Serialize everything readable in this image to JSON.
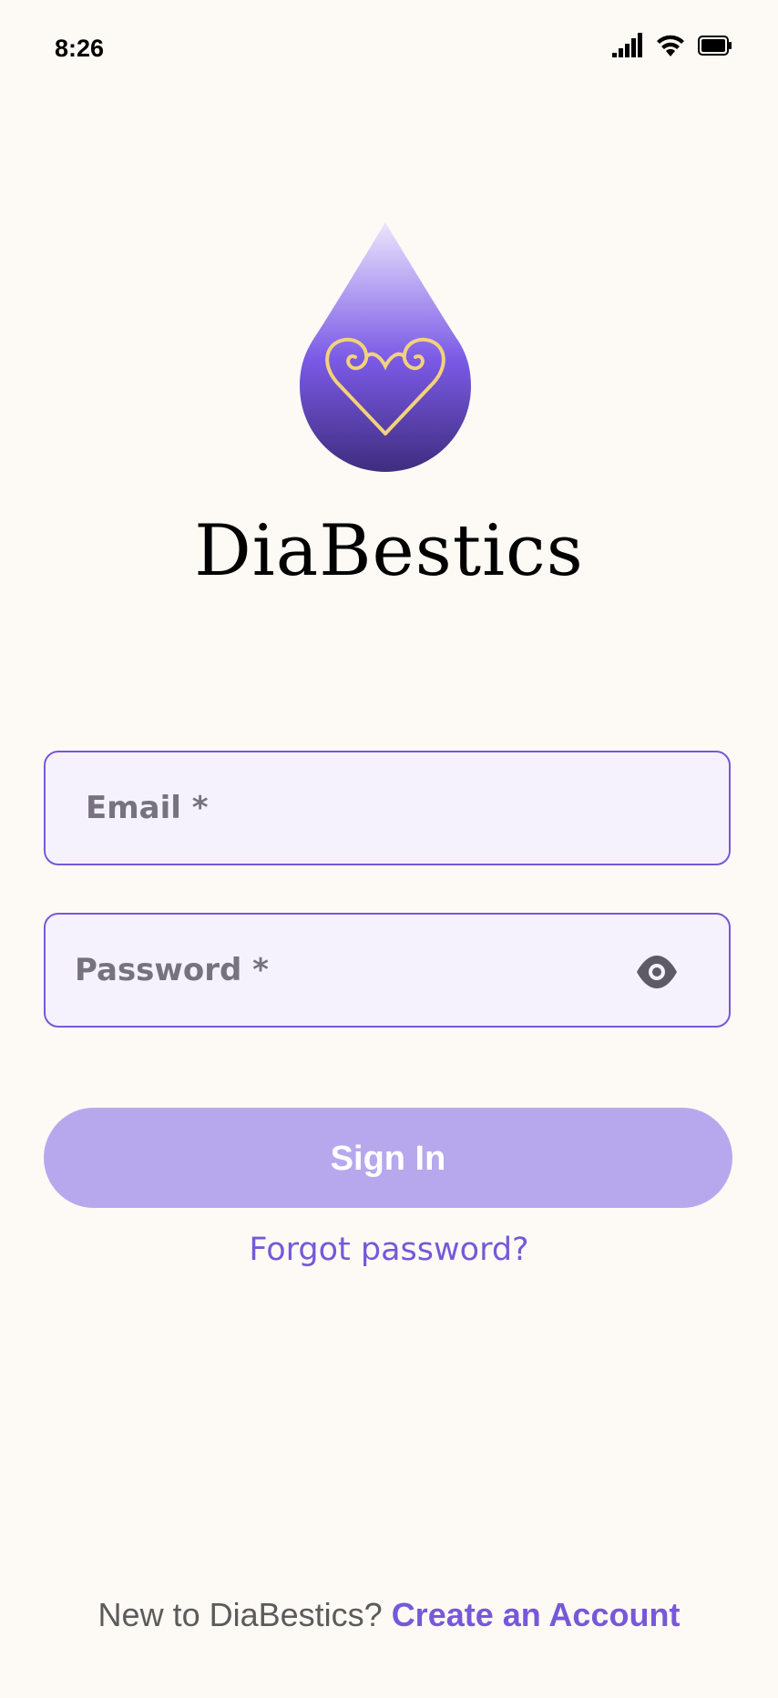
{
  "status_bar": {
    "time": "8:26",
    "icons": [
      "signal-icon",
      "wifi-icon",
      "battery-icon"
    ]
  },
  "brand": {
    "name": "DiaBestics",
    "logo_icon": "heart-drop-icon",
    "colors": {
      "drop_top": "#e4dcfb",
      "drop_mid": "#7a5ae6",
      "drop_bottom": "#433085",
      "heart": "#f3d27a"
    }
  },
  "login_form": {
    "email_placeholder": "Email *",
    "email_value": "",
    "password_placeholder": "Password *",
    "password_value": "",
    "visibility_icon": "eye-icon",
    "sign_in_label": "Sign In",
    "forgot_label": "Forgot password?"
  },
  "footer": {
    "prompt": "New to DiaBestics?",
    "create_account_label": "Create an Account"
  },
  "colors": {
    "accent": "#7758d8",
    "button_disabled": "#b7a8ee",
    "background": "#fdfaf5",
    "field_background": "#f5f2fd"
  }
}
